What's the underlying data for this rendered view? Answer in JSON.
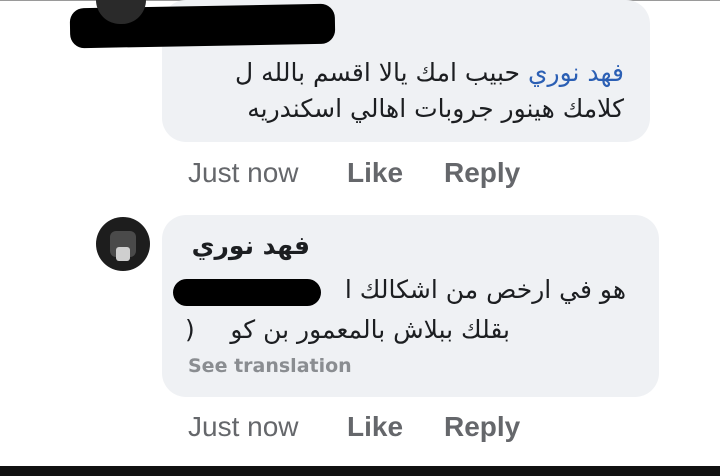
{
  "comment1": {
    "mention": "فهد نوري",
    "text_line1": "حبيب امك يالا اقسم بالله ل",
    "text_line2": "كلامك هينور جروبات اهالي اسكندريه",
    "time": "Just now",
    "like": "Like",
    "reply": "Reply"
  },
  "comment2": {
    "author": "فهد نوري",
    "text_line1_end": "هو في ارخص من اشكالك ا",
    "text_line2": "بقلك ببلاش بالمعمور بن كو",
    "text_line2_end": "(",
    "see_translation": "See translation",
    "time": "Just now",
    "like": "Like",
    "reply": "Reply"
  }
}
